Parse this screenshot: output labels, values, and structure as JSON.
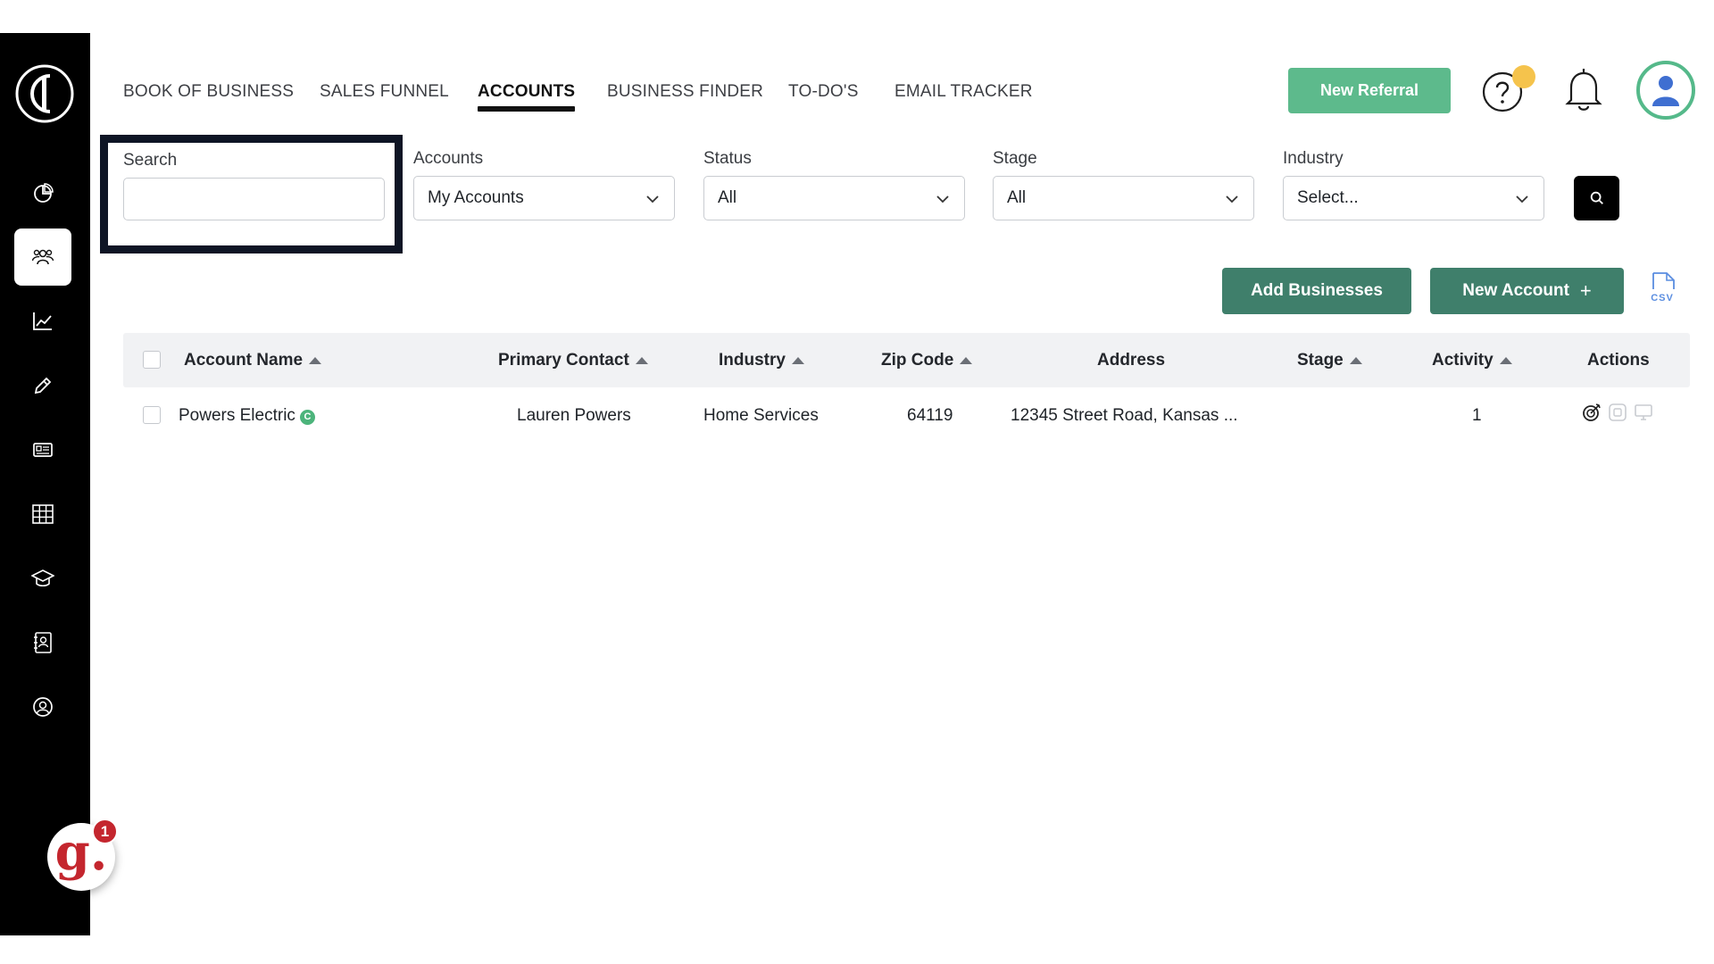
{
  "nav": {
    "tabs": [
      {
        "label": "BOOK OF BUSINESS"
      },
      {
        "label": "SALES FUNNEL"
      },
      {
        "label": "ACCOUNTS",
        "active": true
      },
      {
        "label": "BUSINESS FINDER"
      },
      {
        "label": "TO-DO'S"
      },
      {
        "label": "EMAIL TRACKER"
      }
    ],
    "new_referral_label": "New Referral"
  },
  "sidebar": {
    "items": [
      {
        "icon": "pie-chart-icon"
      },
      {
        "icon": "users-icon",
        "active": true
      },
      {
        "icon": "trending-chart-icon"
      },
      {
        "icon": "pencil-icon"
      },
      {
        "icon": "newspaper-icon"
      },
      {
        "icon": "grid-table-icon"
      },
      {
        "icon": "graduation-cap-icon"
      },
      {
        "icon": "contact-book-icon"
      },
      {
        "icon": "user-circle-icon"
      }
    ],
    "chat_widget": {
      "letter": "g.",
      "badge": "1"
    }
  },
  "filters": {
    "search": {
      "label": "Search",
      "value": ""
    },
    "accounts": {
      "label": "Accounts",
      "value": "My Accounts"
    },
    "status": {
      "label": "Status",
      "value": "All"
    },
    "stage": {
      "label": "Stage",
      "value": "All"
    },
    "industry": {
      "label": "Industry",
      "value": "Select..."
    }
  },
  "actions": {
    "add_businesses_label": "Add Businesses",
    "new_account_label": "New Account",
    "new_account_plus": "+",
    "csv_label": "CSV"
  },
  "table": {
    "columns": {
      "account_name": "Account Name",
      "primary_contact": "Primary Contact",
      "industry": "Industry",
      "zip_code": "Zip Code",
      "address": "Address",
      "stage": "Stage",
      "activity": "Activity",
      "actions": "Actions"
    },
    "rows": [
      {
        "account_name": "Powers Electric",
        "badge": "C",
        "primary_contact": "Lauren Powers",
        "industry": "Home Services",
        "zip_code": "64119",
        "address": "12345 Street Road, Kansas ...",
        "stage": "",
        "activity": "1"
      }
    ]
  },
  "colors": {
    "accent_green": "#5dba8c",
    "dark_green": "#3f7f6b",
    "sidebar_bg": "#000000",
    "highlight_frame": "#0e1525",
    "notification_yellow": "#f5c34c",
    "chat_red": "#c4262e"
  }
}
